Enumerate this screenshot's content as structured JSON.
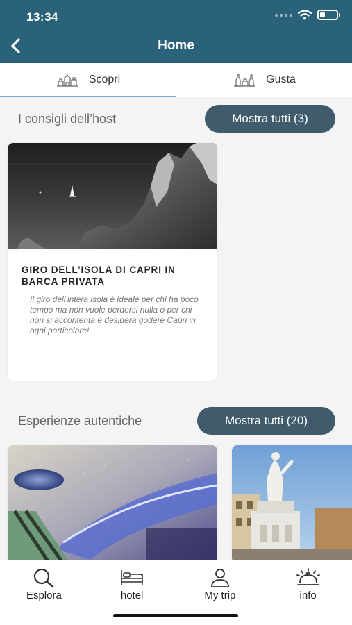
{
  "status_bar": {
    "time": "13:34",
    "battery_level": 0.3
  },
  "nav": {
    "title": "Home"
  },
  "tabs": [
    {
      "label": "Scopri",
      "icon": "landmark-icon",
      "active": true
    },
    {
      "label": "Gusta",
      "icon": "food-drink-icon",
      "active": false
    }
  ],
  "sections": {
    "host_tips": {
      "title": "I consigli dell’host",
      "show_all_label": "Mostra tutti (3)",
      "card": {
        "image": "capri-coast-photo",
        "title": "GIRO DELL’ISOLA DI CAPRI IN BARCA PRIVATA",
        "description": "Il giro dell’intera isola è ideale per chi ha poco tempo ma non vuole perdersi nulla o per chi non si accontenta e desidera godere Capri in ogni particolare!"
      }
    },
    "experiences": {
      "title": "Esperienze autentiche",
      "show_all_label": "Mostra tutti (20)",
      "cards": [
        {
          "image": "toledo-metro-station-photo"
        },
        {
          "image": "dante-statue-square-photo"
        }
      ]
    }
  },
  "bottom_nav": [
    {
      "label": "Esplora",
      "icon": "search-icon"
    },
    {
      "label": "hotel",
      "icon": "bed-icon"
    },
    {
      "label": "My trip",
      "icon": "user-icon"
    },
    {
      "label": "info",
      "icon": "reception-bell-icon"
    }
  ]
}
